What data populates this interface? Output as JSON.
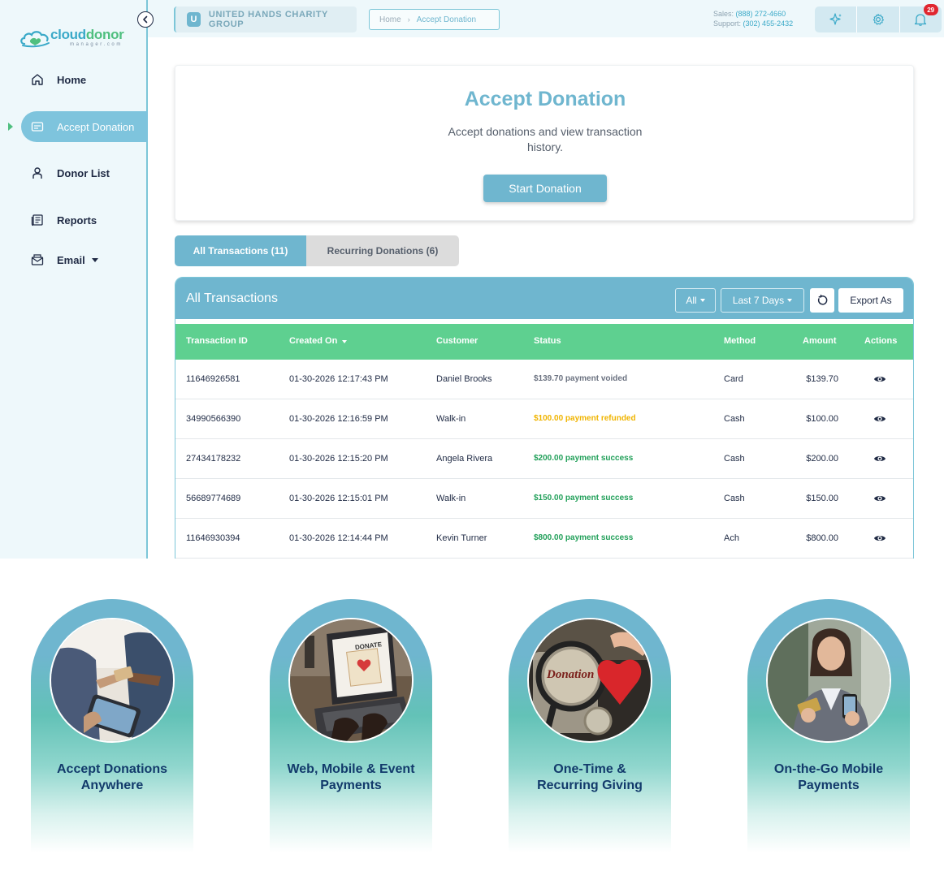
{
  "brand": {
    "logo_main_1": "cloud",
    "logo_main_2": "donor",
    "logo_sub": "manager.com"
  },
  "sidebar": {
    "items": [
      {
        "label": "Home",
        "icon": "home-icon"
      },
      {
        "label": "Accept Donation",
        "icon": "credit-card-icon",
        "active": true
      },
      {
        "label": "Donor List",
        "icon": "user-icon"
      },
      {
        "label": "Reports",
        "icon": "report-icon"
      },
      {
        "label": "Email",
        "icon": "envelope-icon",
        "has_dropdown": true
      }
    ]
  },
  "header": {
    "org_initial": "U",
    "org_name": "UNITED HANDS CHARITY GROUP",
    "breadcrumb_home": "Home",
    "breadcrumb_current": "Accept Donation",
    "sales_label": "Sales:",
    "sales_number": "(888) 272-4660",
    "support_label": "Support:",
    "support_number": "(302) 455-2432",
    "notification_count": "29"
  },
  "hero": {
    "title": "Accept Donation",
    "subtitle": "Accept donations and view transaction history.",
    "button": "Start Donation"
  },
  "tabs": [
    {
      "label": "All Transactions (11)",
      "active": true
    },
    {
      "label": "Recurring Donations (6)",
      "active": false
    }
  ],
  "transactions": {
    "title": "All Transactions",
    "filter_type": "All",
    "filter_range": "Last 7 Days",
    "export_label": "Export As",
    "columns": [
      "Transaction ID",
      "Created On",
      "Customer",
      "Status",
      "Method",
      "Amount",
      "Actions"
    ],
    "rows": [
      {
        "id": "11646926581",
        "created": "01-30-2026 12:17:43 PM",
        "customer": "Daniel Brooks",
        "status": "$139.70 payment voided",
        "status_type": "void",
        "method": "Card",
        "amount": "$139.70"
      },
      {
        "id": "34990566390",
        "created": "01-30-2026 12:16:59 PM",
        "customer": "Walk-in",
        "status": "$100.00 payment refunded",
        "status_type": "refund",
        "method": "Cash",
        "amount": "$100.00"
      },
      {
        "id": "27434178232",
        "created": "01-30-2026 12:15:20 PM",
        "customer": "Angela Rivera",
        "status": "$200.00 payment success",
        "status_type": "success",
        "method": "Cash",
        "amount": "$200.00"
      },
      {
        "id": "56689774689",
        "created": "01-30-2026 12:15:01 PM",
        "customer": "Walk-in",
        "status": "$150.00 payment success",
        "status_type": "success",
        "method": "Cash",
        "amount": "$150.00"
      },
      {
        "id": "11646930394",
        "created": "01-30-2026 12:14:44 PM",
        "customer": "Kevin Turner",
        "status": "$800.00 payment success",
        "status_type": "success",
        "method": "Ach",
        "amount": "$800.00"
      }
    ]
  },
  "features": [
    {
      "line1": "Accept Donations",
      "line2": "Anywhere"
    },
    {
      "line1": "Web, Mobile & Event",
      "line2": "Payments"
    },
    {
      "line1": "One-Time &",
      "line2": "Recurring Giving"
    },
    {
      "line1": "On-the-Go Mobile",
      "line2": "Payments"
    }
  ],
  "photo_text": {
    "laptop_screen": "DONATE",
    "jar_label": "Donation"
  },
  "colors": {
    "primary": "#6fb6cf",
    "table_header": "#5ed090",
    "success": "#22a05a",
    "refund": "#f0b400",
    "void": "#6b7280",
    "feature_text": "#123a6b"
  }
}
